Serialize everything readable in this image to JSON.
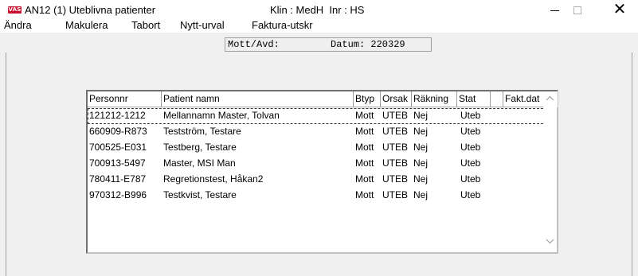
{
  "window": {
    "icon_label": "VAS",
    "title": "AN12 (1) Uteblivna patienter",
    "title_info": "Klin : MedH  Inr : HS",
    "close_glyph": "✕"
  },
  "menu": [
    "Ändra",
    "Makulera",
    "Tabort",
    "Nytt-urval",
    "Faktura-utskr"
  ],
  "header": {
    "mott_label": "Mott/Avd:",
    "datum_text": "Datum: 220329"
  },
  "table": {
    "columns": [
      "Personnr",
      "Patient namn",
      "Btyp",
      "Orsak",
      "Räkning",
      "Stat",
      "",
      "Fakt.dat"
    ],
    "rows": [
      [
        "121212-1212",
        "Mellannamn Master, Tolvan",
        "Mott",
        "UTEB",
        "Nej",
        "Uteb",
        "",
        ""
      ],
      [
        "660909-R873",
        "Testström, Testare",
        "Mott",
        "UTEB",
        "Nej",
        "Uteb",
        "",
        ""
      ],
      [
        "700525-E031",
        "Testberg, Testare",
        "Mott",
        "UTEB",
        "Nej",
        "Uteb",
        "",
        ""
      ],
      [
        "700913-5497",
        "Master, MSI Man",
        "Mott",
        "UTEB",
        "Nej",
        "Uteb",
        "",
        ""
      ],
      [
        "780411-E787",
        "Regretionstest, Håkan2",
        "Mott",
        "UTEB",
        "Nej",
        "Uteb",
        "",
        ""
      ],
      [
        "970312-B996",
        "Testkvist, Testare",
        "Mott",
        "UTEB",
        "Nej",
        "Uteb",
        "",
        ""
      ]
    ],
    "selected_row": 0
  },
  "colors": {
    "icon_red": "#c8102e",
    "window_bg": "#f0f0f0"
  }
}
